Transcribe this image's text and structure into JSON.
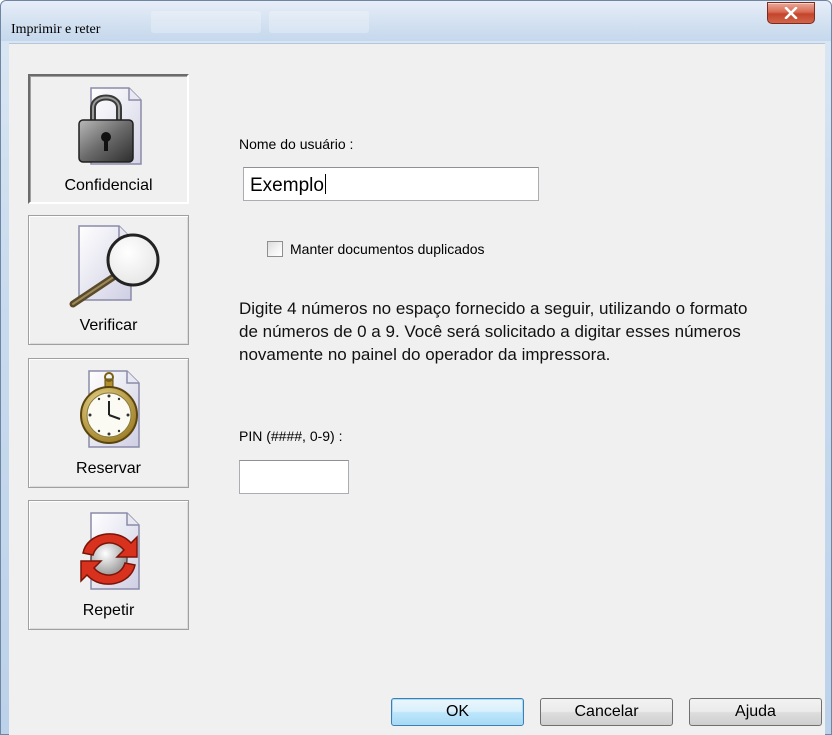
{
  "window": {
    "title": "Imprimir e reter",
    "close_glyph": "x"
  },
  "sidebar": {
    "items": [
      {
        "label": "Confidencial",
        "icon": "padlock-document-icon",
        "active": true
      },
      {
        "label": "Verificar",
        "icon": "magnifier-document-icon",
        "active": false
      },
      {
        "label": "Reservar",
        "icon": "stopwatch-document-icon",
        "active": false
      },
      {
        "label": "Repetir",
        "icon": "repeat-arrows-document-icon",
        "active": false
      }
    ]
  },
  "form": {
    "username_label": "Nome do usuário :",
    "username_value": "Exemplo",
    "keep_duplicates_label": "Manter documentos duplicados",
    "keep_duplicates_checked": false,
    "instructions": "Digite 4 números no espaço fornecido a seguir, utilizando o formato de números de 0 a 9. Você será solicitado a digitar esses números novamente no painel do operador da impressora.",
    "pin_label": "PIN (####, 0-9) :",
    "pin_value": ""
  },
  "buttons": {
    "ok": "OK",
    "cancel": "Cancelar",
    "help": "Ajuda"
  }
}
